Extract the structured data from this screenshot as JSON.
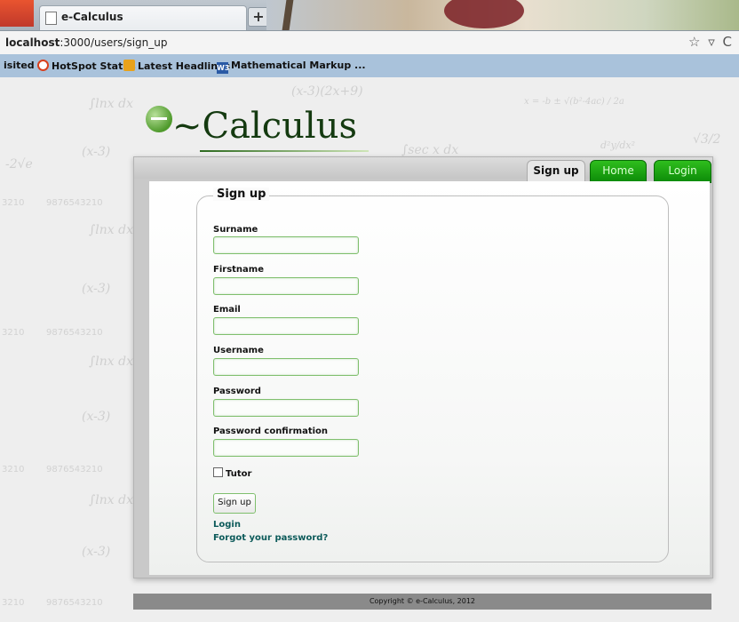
{
  "browser": {
    "tab_title": "e-Calculus",
    "new_tab_label": "+",
    "url_host": "localhost",
    "url_path": ":3000/users/sign_up",
    "url_controls": "☆ ▿ C",
    "bookmarks": [
      {
        "label": "isited",
        "icon": "none"
      },
      {
        "label": "HotSpot Status",
        "icon": "target-icon"
      },
      {
        "label": "Latest Headlines",
        "icon": "feed-icon"
      },
      {
        "label": "Mathematical Markup ...",
        "icon": "w3-icon"
      }
    ]
  },
  "background": {
    "formulas": [
      "∫lnx dx",
      "(x-3)(2x+9)",
      "x = -b ± √(b²-4ac) / 2a",
      "(x-3)",
      "9876543210",
      "3210",
      "∫sec x dx",
      "d²y/dx²",
      "-2√e",
      "√3/2"
    ]
  },
  "site": {
    "logo_text": "~Calculus",
    "nav": {
      "signup": "Sign up",
      "home": "Home",
      "login": "Login"
    }
  },
  "form": {
    "legend": "Sign up",
    "fields": [
      {
        "label": "Surname",
        "value": ""
      },
      {
        "label": "Firstname",
        "value": ""
      },
      {
        "label": "Email",
        "value": ""
      },
      {
        "label": "Username",
        "value": ""
      },
      {
        "label": "Password",
        "value": ""
      },
      {
        "label": "Password confirmation",
        "value": ""
      }
    ],
    "tutor_label": "Tutor",
    "tutor_checked": false,
    "submit_label": "Sign up",
    "login_link": "Login",
    "forgot_link": "Forgot your password?"
  },
  "footer": {
    "copyright": "Copyright © e-Calculus, 2012"
  }
}
